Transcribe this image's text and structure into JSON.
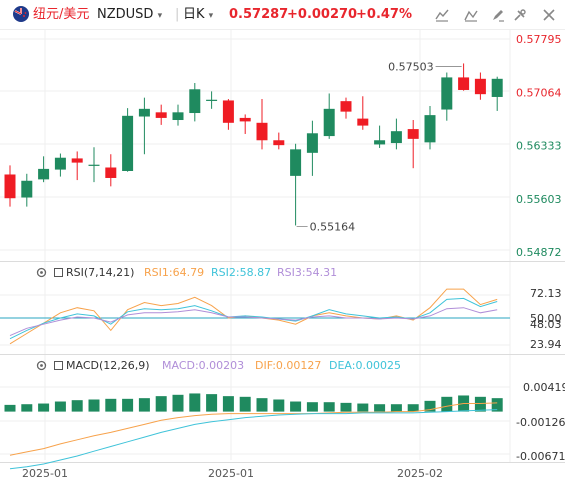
{
  "header": {
    "name_cn": "纽元/美元",
    "symbol": "NZDUSD",
    "symbol_caret": "▾",
    "timeframe": "日K",
    "timeframe_caret": "▾",
    "price": "0.57287",
    "change": "+0.00270",
    "change_pct": "+0.47%"
  },
  "toolbar": [
    "chart-type-icon",
    "indicator-icon",
    "draw-icon",
    "settings-icon",
    "fullscreen-icon",
    "close-icon"
  ],
  "rsi": {
    "title": "RSI(7,14,21)",
    "rsi1": "RSI1:64.79",
    "rsi2": "RSI2:58.87",
    "rsi3": "RSI3:54.31"
  },
  "macd": {
    "title": "MACD(12,26,9)",
    "macd": "MACD:0.00203",
    "dif": "DIF:0.00127",
    "dea": "DEA:0.00025"
  },
  "colors": {
    "up": "#1f8a5f",
    "down": "#ef1c24",
    "rsi1": "#f7a24b",
    "rsi2": "#3fc3d9",
    "rsi3": "#b08ed8",
    "dif": "#f7a24b",
    "dea": "#3fc3d9",
    "price_pos": "#e8262d",
    "refline": "#2aa6c2"
  },
  "chart_data": [
    {
      "type": "candlestick",
      "title": "NZDUSD",
      "ylim": [
        0.548,
        0.5785
      ],
      "y_ticks": [
        "0.57795",
        "0.57064",
        "0.56333",
        "0.55603",
        "0.54872"
      ],
      "x_ticks": [
        "2025-01",
        "2025-01",
        "2025-02"
      ],
      "annotations": [
        {
          "label": "0.57503",
          "kind": "high"
        },
        {
          "label": "0.55164",
          "kind": "low"
        }
      ],
      "candles": [
        {
          "o": 0.5591,
          "h": 0.5604,
          "l": 0.5545,
          "c": 0.5557
        },
        {
          "o": 0.5558,
          "h": 0.5592,
          "l": 0.5545,
          "c": 0.5582
        },
        {
          "o": 0.5584,
          "h": 0.5617,
          "l": 0.558,
          "c": 0.5599
        },
        {
          "o": 0.5598,
          "h": 0.5621,
          "l": 0.5588,
          "c": 0.5615
        },
        {
          "o": 0.5614,
          "h": 0.5624,
          "l": 0.5583,
          "c": 0.5608
        },
        {
          "o": 0.5605,
          "h": 0.563,
          "l": 0.558,
          "c": 0.5605
        },
        {
          "o": 0.5601,
          "h": 0.562,
          "l": 0.5574,
          "c": 0.5586
        },
        {
          "o": 0.5596,
          "h": 0.5686,
          "l": 0.5595,
          "c": 0.5675
        },
        {
          "o": 0.5674,
          "h": 0.5701,
          "l": 0.562,
          "c": 0.5685
        },
        {
          "o": 0.568,
          "h": 0.5691,
          "l": 0.5662,
          "c": 0.5672
        },
        {
          "o": 0.5669,
          "h": 0.5691,
          "l": 0.5661,
          "c": 0.568
        },
        {
          "o": 0.5679,
          "h": 0.5722,
          "l": 0.5667,
          "c": 0.5713
        },
        {
          "o": 0.5698,
          "h": 0.571,
          "l": 0.5685,
          "c": 0.5698
        },
        {
          "o": 0.5697,
          "h": 0.5699,
          "l": 0.5655,
          "c": 0.5665
        },
        {
          "o": 0.5672,
          "h": 0.5677,
          "l": 0.5649,
          "c": 0.5667
        },
        {
          "o": 0.5665,
          "h": 0.5699,
          "l": 0.5627,
          "c": 0.564
        },
        {
          "o": 0.564,
          "h": 0.5651,
          "l": 0.5627,
          "c": 0.5633
        },
        {
          "o": 0.5589,
          "h": 0.5635,
          "l": 0.5518,
          "c": 0.5627
        },
        {
          "o": 0.5622,
          "h": 0.5668,
          "l": 0.5589,
          "c": 0.565
        },
        {
          "o": 0.5646,
          "h": 0.5707,
          "l": 0.5642,
          "c": 0.5685
        },
        {
          "o": 0.5696,
          "h": 0.5701,
          "l": 0.5671,
          "c": 0.5681
        },
        {
          "o": 0.5671,
          "h": 0.5703,
          "l": 0.5655,
          "c": 0.5661
        },
        {
          "o": 0.5634,
          "h": 0.5661,
          "l": 0.5629,
          "c": 0.564
        },
        {
          "o": 0.5636,
          "h": 0.5671,
          "l": 0.5627,
          "c": 0.5653
        },
        {
          "o": 0.5656,
          "h": 0.5669,
          "l": 0.56,
          "c": 0.5642
        },
        {
          "o": 0.5637,
          "h": 0.5689,
          "l": 0.5627,
          "c": 0.5676
        },
        {
          "o": 0.5684,
          "h": 0.5737,
          "l": 0.5668,
          "c": 0.573
        },
        {
          "o": 0.573,
          "h": 0.575,
          "l": 0.5711,
          "c": 0.5712
        },
        {
          "o": 0.5728,
          "h": 0.5737,
          "l": 0.5698,
          "c": 0.5706
        },
        {
          "o": 0.5702,
          "h": 0.5731,
          "l": 0.5682,
          "c": 0.5728
        }
      ]
    },
    {
      "type": "line",
      "title": "RSI(7,14,21)",
      "y_ticks": [
        "72.13",
        "50.00",
        "48.03",
        "23.94"
      ],
      "ylim": [
        20,
        80
      ],
      "reference_line": 50,
      "series": [
        {
          "name": "RSI1",
          "values": [
            25,
            35,
            45,
            55,
            60,
            57,
            38,
            58,
            65,
            62,
            64,
            70,
            62,
            50,
            52,
            50,
            48,
            44,
            52,
            55,
            52,
            50,
            49,
            52,
            48,
            60,
            78,
            78,
            63,
            68
          ]
        },
        {
          "name": "RSI2",
          "values": [
            30,
            38,
            45,
            50,
            54,
            52,
            44,
            56,
            59,
            58,
            59,
            62,
            57,
            51,
            52,
            51,
            49,
            47,
            52,
            58,
            54,
            52,
            50,
            51,
            49,
            55,
            68,
            69,
            61,
            66
          ]
        },
        {
          "name": "RSI3",
          "values": [
            33,
            40,
            44,
            48,
            51,
            50,
            46,
            53,
            55,
            55,
            56,
            58,
            55,
            51,
            51,
            50,
            49,
            48,
            51,
            52,
            50,
            50,
            49,
            50,
            49,
            52,
            59,
            60,
            55,
            58
          ]
        }
      ]
    },
    {
      "type": "bar",
      "title": "MACD(12,26,9)",
      "y_ticks": [
        "0.00419",
        "-0.00126",
        "-0.00671"
      ],
      "ylim": [
        -0.0075,
        0.005
      ],
      "macd_hist": [
        0.001,
        0.0011,
        0.0012,
        0.0015,
        0.0017,
        0.0018,
        0.0019,
        0.0019,
        0.002,
        0.0023,
        0.0025,
        0.0027,
        0.0026,
        0.0023,
        0.0022,
        0.002,
        0.0018,
        0.0015,
        0.0014,
        0.0014,
        0.0013,
        0.0012,
        0.0011,
        0.0011,
        0.0011,
        0.0016,
        0.0022,
        0.0024,
        0.0022,
        0.002
      ],
      "series": [
        {
          "name": "DIF",
          "values": [
            -0.0065,
            -0.006,
            -0.0055,
            -0.0048,
            -0.0042,
            -0.0036,
            -0.0031,
            -0.0025,
            -0.0019,
            -0.0013,
            -0.0009,
            -0.0006,
            -0.0004,
            -0.0003,
            -0.0003,
            -0.0003,
            -0.0003,
            -0.0003,
            -0.0003,
            -0.0002,
            -0.0001,
            -0.0001,
            -0.0001,
            0.0,
            0.0,
            0.0003,
            0.0008,
            0.0012,
            0.0012,
            0.0013
          ]
        },
        {
          "name": "DEA",
          "values": [
            -0.0085,
            -0.0082,
            -0.0078,
            -0.0072,
            -0.0066,
            -0.0059,
            -0.0052,
            -0.0045,
            -0.0038,
            -0.0031,
            -0.0025,
            -0.0019,
            -0.0015,
            -0.0012,
            -0.0009,
            -0.0007,
            -0.0005,
            -0.0004,
            -0.0003,
            -0.0003,
            -0.0003,
            -0.0002,
            -0.0002,
            -0.0002,
            -0.0002,
            -0.0001,
            0.0,
            0.0001,
            0.0002,
            0.0003
          ]
        }
      ]
    }
  ]
}
